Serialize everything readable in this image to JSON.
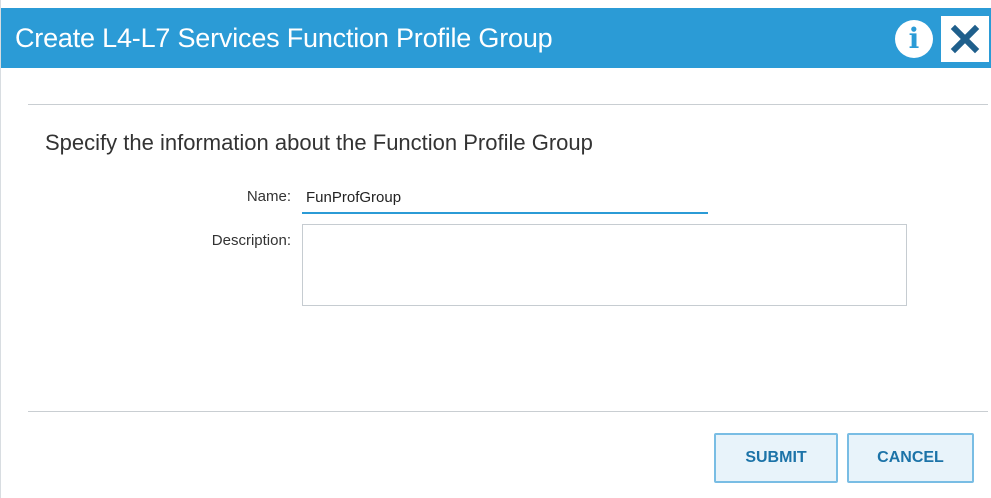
{
  "dialog": {
    "title": "Create L4-L7 Services Function Profile Group",
    "subtitle": "Specify the information about the Function Profile Group"
  },
  "icons": {
    "info": "info-icon",
    "info_glyph": "i",
    "close": "close-icon"
  },
  "form": {
    "name_label": "Name:",
    "name_value": "FunProfGroup",
    "description_label": "Description:",
    "description_value": ""
  },
  "buttons": {
    "submit_label": "SUBMIT",
    "cancel_label": "CANCEL"
  },
  "colors": {
    "titlebar": "#2b9bd6",
    "accent": "#2b9bd6",
    "button_text": "#1c73a8",
    "button_border": "#79bde4"
  }
}
